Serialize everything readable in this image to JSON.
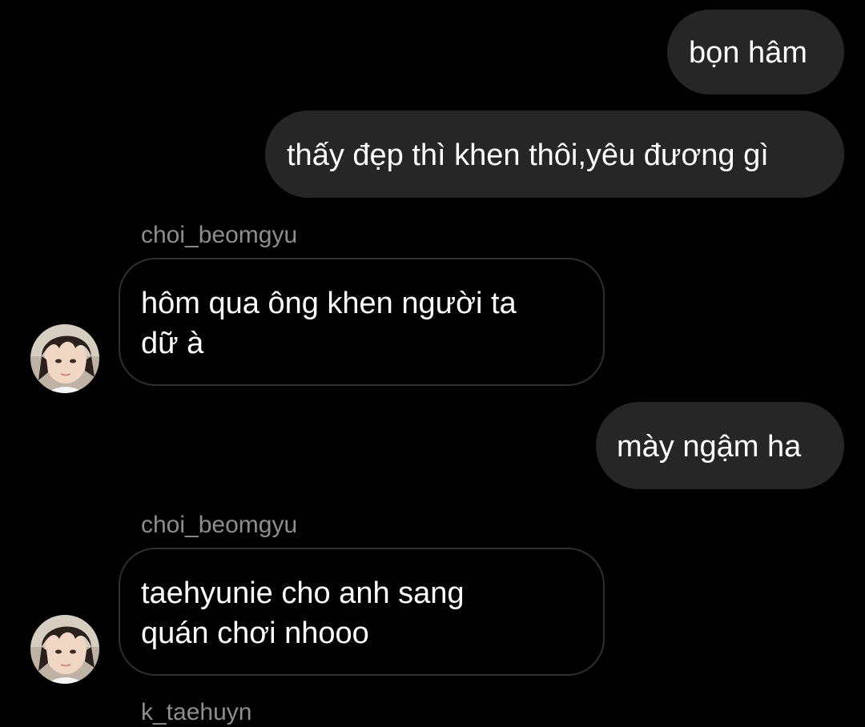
{
  "conversation": {
    "outgoing": [
      {
        "text": "bọn hâm"
      },
      {
        "text": "thấy đẹp thì khen thôi,yêu đương gì"
      },
      {
        "text": "mày ngậm ha"
      }
    ],
    "incoming": [
      {
        "sender": "choi_beomgyu",
        "lines": [
          "hôm qua ông khen người ta",
          "dữ à"
        ]
      },
      {
        "sender": "choi_beomgyu",
        "lines": [
          "taehyunie cho anh sang",
          "quán chơi nhooo"
        ]
      }
    ],
    "next_sender": "k_taehuyn"
  },
  "colors": {
    "background": "#000000",
    "outgoing_bubble": "#262626",
    "incoming_border": "#303030",
    "sender_text": "#8e8e8e",
    "message_text": "#ffffff"
  },
  "icons": {
    "avatar": "profile-photo"
  }
}
